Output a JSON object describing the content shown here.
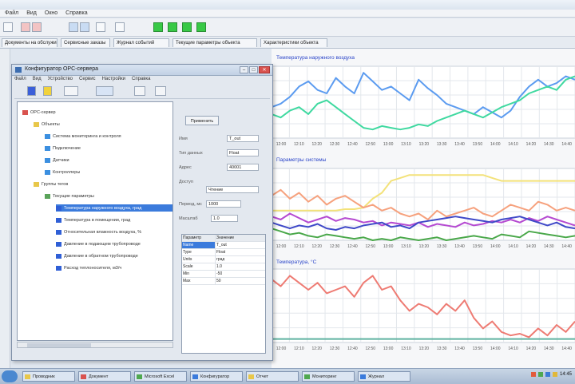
{
  "app": {
    "menu": [
      "Файл",
      "Вид",
      "Окно",
      "Справка"
    ],
    "tabs": [
      "Документы на обслуживание",
      "Сервисные заказы",
      "Журнал событий",
      "Текущие параметры объекта",
      "Характеристики объекта"
    ]
  },
  "dialog": {
    "title": "Конфигуратор OPC-сервера",
    "menu": [
      "Файл",
      "Вид",
      "Устройство",
      "Сервис",
      "Настройки",
      "Справка"
    ],
    "tree": [
      {
        "label": "OPC-сервер",
        "level": 0,
        "icon": "server-icon"
      },
      {
        "label": "Объекты",
        "level": 1,
        "icon": "folder-icon"
      },
      {
        "label": "Система мониторинга и контроля",
        "level": 2,
        "icon": "device-icon"
      },
      {
        "label": "Подключение",
        "level": 2,
        "icon": "device-icon"
      },
      {
        "label": "Датчики",
        "level": 2,
        "icon": "device-icon"
      },
      {
        "label": "Контроллеры",
        "level": 2,
        "icon": "device-icon"
      },
      {
        "label": "Группы тегов",
        "level": 1,
        "icon": "folder-icon"
      },
      {
        "label": "Текущие параметры",
        "level": 2,
        "icon": "group-icon"
      },
      {
        "label": "Температура наружного воздуха, град",
        "level": 3,
        "icon": "tag-icon",
        "selected": true
      },
      {
        "label": "Температура в помещении, град",
        "level": 3,
        "icon": "tag-icon"
      },
      {
        "label": "Относительная влажность воздуха, %",
        "level": 3,
        "icon": "tag-icon"
      },
      {
        "label": "Давление в подающем трубопроводе",
        "level": 3,
        "icon": "tag-icon"
      },
      {
        "label": "Давление в обратном трубопроводе",
        "level": 3,
        "icon": "tag-icon"
      },
      {
        "label": "Расход теплоносителя, м3/ч",
        "level": 3,
        "icon": "tag-icon"
      }
    ],
    "props": {
      "apply_label": "Применить",
      "fields": [
        {
          "label": "Имя",
          "value": "T_out"
        },
        {
          "label": "Тип данных",
          "value": "Float"
        },
        {
          "label": "Адрес",
          "value": "40001"
        },
        {
          "label": "Доступ",
          "value": "Чтение"
        },
        {
          "label": "Период, мс",
          "value": "1000"
        },
        {
          "label": "Масштаб",
          "value": "1.0"
        }
      ]
    },
    "grid": {
      "headers": [
        "Параметр",
        "Значение"
      ],
      "rows": [
        [
          "Name",
          "T_out"
        ],
        [
          "Type",
          "Float"
        ],
        [
          "Units",
          "град"
        ],
        [
          "Scale",
          "1.0"
        ],
        [
          "Min",
          "-50"
        ],
        [
          "Max",
          "50"
        ]
      ]
    }
  },
  "charts": [
    {
      "title": "Температура наружного воздуха",
      "time_labels": [
        "12:00",
        "12:10",
        "12:20",
        "12:30",
        "12:40",
        "12:50",
        "13:00",
        "13:10",
        "13:20",
        "13:30",
        "13:40",
        "13:50",
        "14:00",
        "14:10",
        "14:20",
        "14:30",
        "14:40"
      ],
      "series": [
        {
          "color": "#5b9bf0",
          "values": [
            18,
            20,
            24,
            30,
            33,
            28,
            26,
            35,
            30,
            26,
            38,
            33,
            28,
            30,
            26,
            22,
            34,
            29,
            25,
            20,
            18,
            16,
            14,
            18,
            15,
            12,
            16,
            24,
            30,
            34,
            30,
            32,
            36,
            34
          ]
        },
        {
          "color": "#3fd9a0",
          "values": [
            14,
            12,
            16,
            18,
            14,
            20,
            22,
            18,
            14,
            10,
            6,
            5,
            7,
            6,
            5,
            6,
            8,
            7,
            10,
            12,
            14,
            16,
            14,
            12,
            15,
            18,
            20,
            22,
            26,
            28,
            30,
            28,
            34,
            36
          ]
        }
      ]
    },
    {
      "title": "Параметры системы",
      "time_labels": [
        "12:00",
        "12:10",
        "12:20",
        "12:30",
        "12:40",
        "12:50",
        "13:00",
        "13:10",
        "13:20",
        "13:30",
        "13:40",
        "13:50",
        "14:00",
        "14:10",
        "14:20",
        "14:30",
        "14:40"
      ],
      "series": [
        {
          "color": "#f3e27a",
          "values": [
            20,
            20,
            20,
            20,
            20,
            20,
            20,
            20,
            21,
            21,
            22,
            28,
            32,
            40,
            42,
            44,
            44,
            44,
            44,
            44,
            44,
            44,
            44,
            44,
            42,
            40,
            40,
            40,
            40,
            40,
            40,
            40,
            40,
            40
          ]
        },
        {
          "color": "#f6a17d",
          "values": [
            30,
            34,
            28,
            32,
            26,
            30,
            24,
            28,
            30,
            26,
            22,
            24,
            20,
            22,
            18,
            16,
            18,
            14,
            20,
            16,
            18,
            20,
            22,
            18,
            16,
            20,
            24,
            22,
            20,
            26,
            24,
            20,
            22,
            20
          ]
        },
        {
          "color": "#b54ad1",
          "values": [
            16,
            14,
            18,
            15,
            12,
            14,
            16,
            13,
            15,
            14,
            12,
            13,
            10,
            12,
            11,
            10,
            12,
            9,
            11,
            10,
            9,
            12,
            10,
            11,
            13,
            12,
            14,
            12,
            15,
            13,
            16,
            14,
            12,
            10
          ]
        },
        {
          "color": "#3f49c8",
          "values": [
            12,
            10,
            8,
            10,
            9,
            11,
            8,
            7,
            9,
            8,
            10,
            11,
            12,
            9,
            10,
            8,
            12,
            13,
            14,
            15,
            16,
            15,
            14,
            13,
            12,
            14,
            15,
            16,
            14,
            12,
            10,
            12,
            9,
            8
          ]
        },
        {
          "color": "#4aa84a",
          "values": [
            8,
            6,
            4,
            5,
            3,
            2,
            4,
            3,
            2,
            1,
            2,
            0,
            1,
            0,
            2,
            1,
            0,
            1,
            2,
            0,
            1,
            2,
            3,
            2,
            1,
            4,
            3,
            2,
            6,
            5,
            4,
            3,
            2,
            3
          ]
        }
      ]
    },
    {
      "title": "Температура, °С",
      "time_labels": [
        "12:00",
        "12:10",
        "12:20",
        "12:30",
        "12:40",
        "12:50",
        "13:00",
        "13:10",
        "13:20",
        "13:30",
        "13:40",
        "13:50",
        "14:00",
        "14:10",
        "14:20",
        "14:30",
        "14:40"
      ],
      "series": [
        {
          "color": "#ee7b73",
          "values": [
            36,
            32,
            38,
            34,
            30,
            34,
            28,
            30,
            32,
            26,
            34,
            38,
            30,
            32,
            24,
            18,
            22,
            20,
            16,
            22,
            18,
            24,
            14,
            8,
            12,
            6,
            4,
            5,
            3,
            8,
            4,
            10,
            6,
            12
          ]
        },
        {
          "color": "#5fb2a0",
          "values": [
            2,
            2,
            2,
            2,
            2,
            2,
            2,
            2,
            2,
            2,
            2,
            2,
            2,
            2,
            2,
            2,
            2,
            2,
            2,
            2,
            2,
            2,
            2,
            2,
            2,
            2,
            2,
            2,
            2,
            2,
            2,
            2,
            2,
            2
          ]
        }
      ]
    }
  ],
  "taskbar": {
    "tasks": [
      "Проводник",
      "Документ",
      "Microsoft Excel",
      "Конфигуратор",
      "Отчет",
      "Мониторинг",
      "Журнал"
    ],
    "clock": "14:45"
  }
}
